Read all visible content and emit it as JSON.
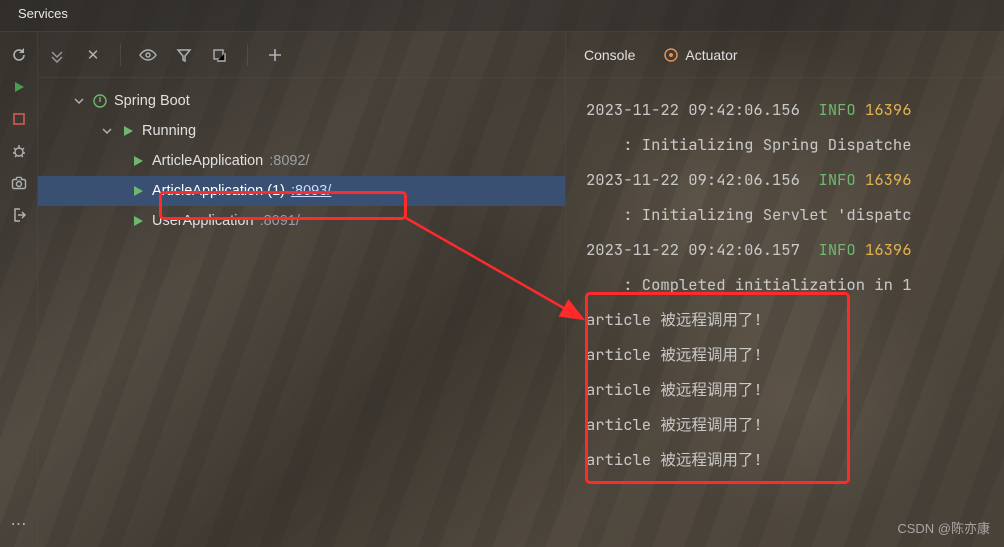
{
  "title": "Services",
  "tree": {
    "root": {
      "label": "Spring Boot"
    },
    "running": {
      "label": "Running"
    },
    "apps": [
      {
        "name": "ArticleApplication",
        "port": ":8092/"
      },
      {
        "name": "ArticleApplication (1)",
        "port": ":8093/"
      },
      {
        "name": "UserApplication",
        "port": ":8091/"
      }
    ]
  },
  "tabs": {
    "console": "Console",
    "actuator": "Actuator"
  },
  "log": {
    "ts1": "2023-11-22 09:42:06.156",
    "ts2": "2023-11-22 09:42:06.156",
    "ts3": "2023-11-22 09:42:06.157",
    "info": "INFO",
    "pid": "16396",
    "line1b": "    : Initializing Spring Dispatche",
    "line2b": "    : Initializing Servlet 'dispatc",
    "line3b": "    : Completed initialization in 1",
    "art_label": "article",
    "art_msg": "被远程调用了!"
  },
  "watermark": "CSDN @陈亦康"
}
